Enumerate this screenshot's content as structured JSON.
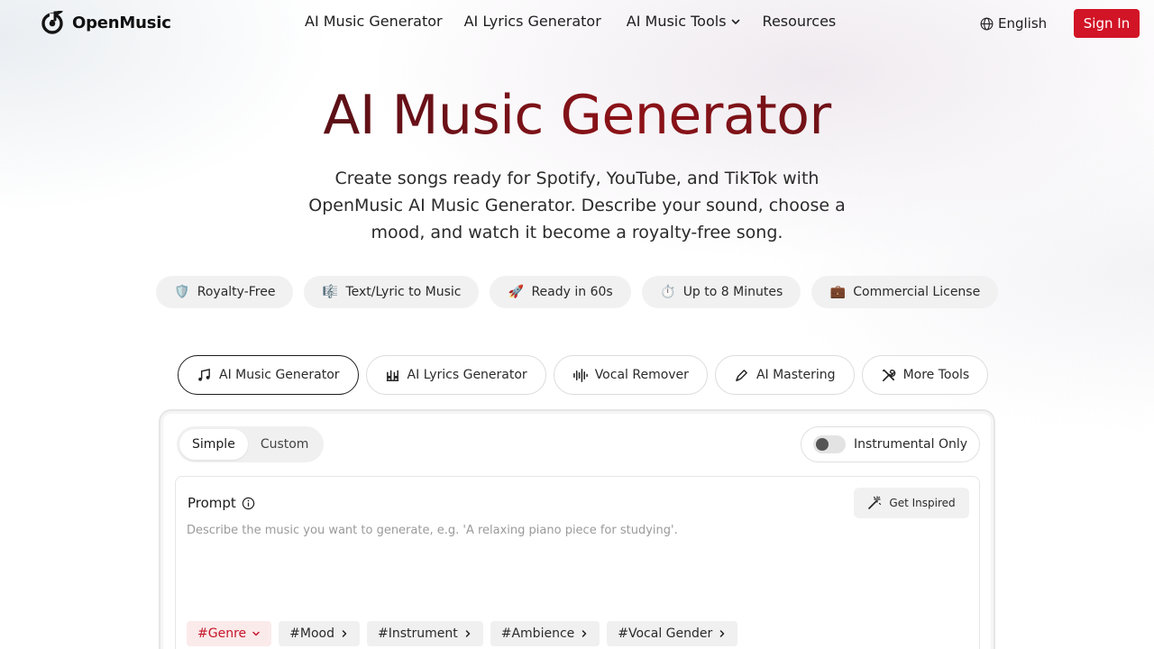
{
  "brand": {
    "name": "OpenMusic",
    "accent": "#d11426"
  },
  "nav": {
    "items": [
      "AI Music Generator",
      "AI Lyrics Generator"
    ],
    "tools_label": "AI Music Tools",
    "resources_label": "Resources",
    "language": "English",
    "sign_in": "Sign In"
  },
  "hero": {
    "title": "AI Music Generator",
    "subtitle": "Create songs ready for Spotify, YouTube, and TikTok with OpenMusic AI Music Generator. Describe your sound, choose a mood, and watch it become a royalty-free song."
  },
  "features": [
    {
      "icon": "shield-icon",
      "emoji": "🛡️",
      "label": "Royalty-Free"
    },
    {
      "icon": "music-score-icon",
      "emoji": "🎼",
      "label": "Text/Lyric to Music"
    },
    {
      "icon": "rocket-icon",
      "emoji": "🚀",
      "label": "Ready in 60s"
    },
    {
      "icon": "stopwatch-icon",
      "emoji": "⏱️",
      "label": "Up to 8 Minutes"
    },
    {
      "icon": "briefcase-icon",
      "emoji": "💼",
      "label": "Commercial License"
    }
  ],
  "tool_tabs": [
    {
      "icon": "music-notes-icon",
      "label": "AI Music Generator",
      "active": true
    },
    {
      "icon": "lyrics-icon",
      "label": "AI Lyrics Generator",
      "active": false
    },
    {
      "icon": "waveform-icon",
      "label": "Vocal Remover",
      "active": false
    },
    {
      "icon": "pen-icon",
      "label": "AI Mastering",
      "active": false
    },
    {
      "icon": "tools-icon",
      "label": "More Tools",
      "active": false
    }
  ],
  "generator": {
    "modes": [
      "Simple",
      "Custom"
    ],
    "active_mode": "Simple",
    "instrumental_label": "Instrumental Only",
    "instrumental_on": false,
    "prompt_label": "Prompt",
    "get_inspired": "Get Inspired",
    "prompt_value": "",
    "prompt_placeholder": "Describe the music you want to generate, e.g. 'A relaxing piano piece for studying'.",
    "tags": [
      "#Genre",
      "#Mood",
      "#Instrument",
      "#Ambience",
      "#Vocal Gender"
    ],
    "active_tag": "#Genre"
  }
}
